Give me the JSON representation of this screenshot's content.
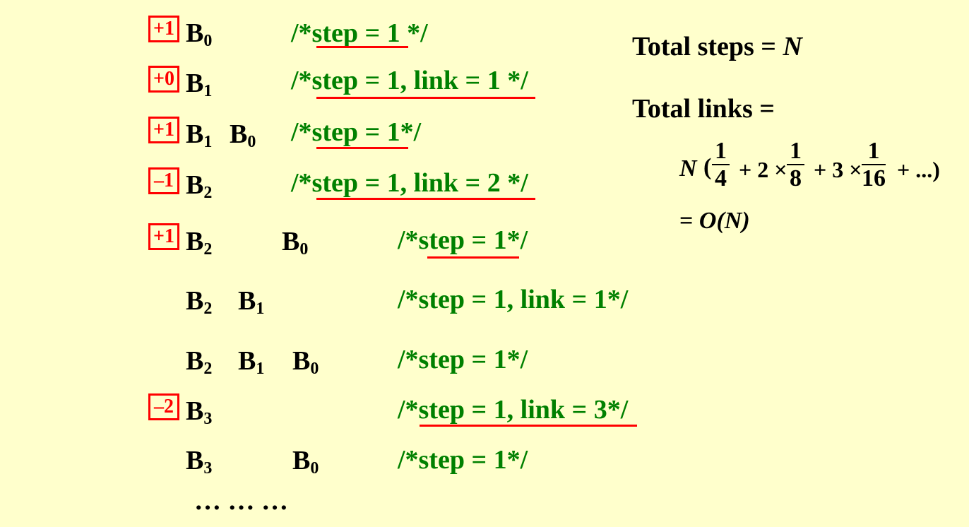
{
  "rows": [
    {
      "badge": "+1",
      "blocks": [
        {
          "b": "B",
          "s": "0"
        }
      ],
      "comment": "/*step = 1 */"
    },
    {
      "badge": "+0",
      "blocks": [
        {
          "b": "B",
          "s": "1"
        }
      ],
      "comment": "/*step = 1, link = 1 */"
    },
    {
      "badge": "+1",
      "blocks": [
        {
          "b": "B",
          "s": "1"
        },
        {
          "b": "B",
          "s": "0"
        }
      ],
      "comment": "/*step = 1*/"
    },
    {
      "badge": "–1",
      "blocks": [
        {
          "b": "B",
          "s": "2"
        }
      ],
      "comment": "/*step = 1, link = 2 */"
    },
    {
      "badge": "+1",
      "blocks": [
        {
          "b": "B",
          "s": "2"
        },
        {
          "b": "B",
          "s": "0"
        }
      ],
      "comment": "/*step = 1*/"
    },
    {
      "badge": "",
      "blocks": [
        {
          "b": "B",
          "s": "2"
        },
        {
          "b": "B",
          "s": "1"
        }
      ],
      "comment": "/*step = 1, link = 1*/"
    },
    {
      "badge": "",
      "blocks": [
        {
          "b": "B",
          "s": "2"
        },
        {
          "b": "B",
          "s": "1"
        },
        {
          "b": "B",
          "s": "0"
        }
      ],
      "comment": "/*step = 1*/"
    },
    {
      "badge": "–2",
      "blocks": [
        {
          "b": "B",
          "s": "3"
        }
      ],
      "comment": "/*step = 1, link = 3*/"
    },
    {
      "badge": "",
      "blocks": [
        {
          "b": "B",
          "s": "3"
        },
        {
          "b": "B",
          "s": "0"
        }
      ],
      "comment": "/*step = 1*/"
    }
  ],
  "ellipsis": "… … …",
  "summary": {
    "total_steps_label": "Total steps = ",
    "total_steps_value": "N",
    "total_links_label": "Total links =",
    "formula": {
      "N": "N",
      "open": "(",
      "f1n": "1",
      "f1d": "4",
      "t2": "+ 2 ×",
      "f2n": "1",
      "f2d": "8",
      "t3": "+ 3 ×",
      "f3n": "1",
      "f3d": "16",
      "tail": "+ ...)"
    },
    "result_eq": "= ",
    "result_O": "O",
    "result_N": "(N)"
  }
}
